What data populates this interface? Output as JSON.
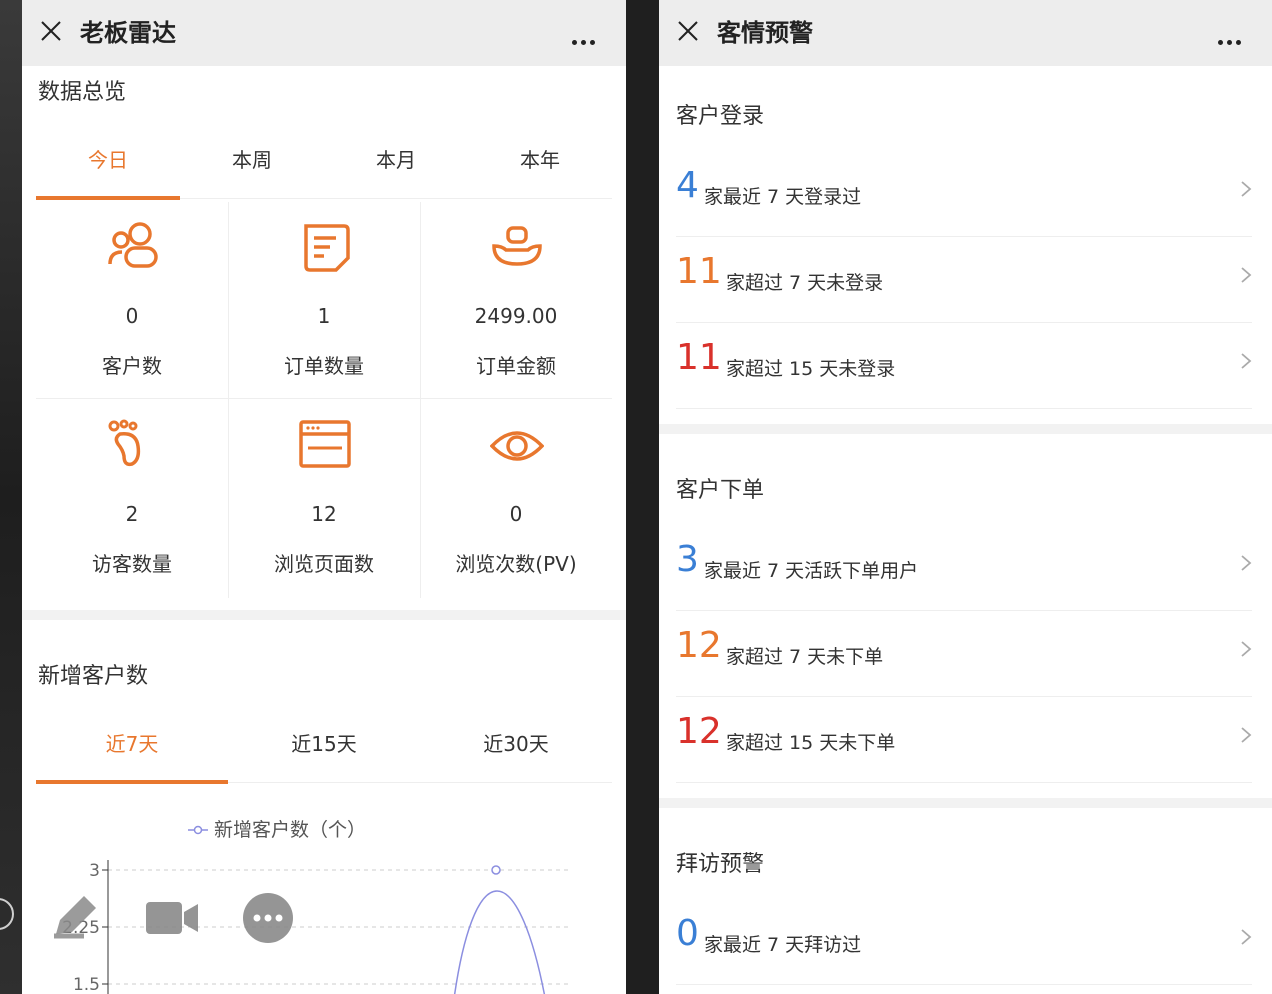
{
  "left": {
    "title": "老板雷达",
    "overview_title": "数据总览",
    "period_tabs": [
      "今日",
      "本周",
      "本月",
      "本年"
    ],
    "stats": [
      {
        "icon": "customers-icon",
        "value": "0",
        "label": "客户数"
      },
      {
        "icon": "order-document-icon",
        "value": "1",
        "label": "订单数量"
      },
      {
        "icon": "gold-ingot-icon",
        "value": "2499.00",
        "label": "订单金额"
      },
      {
        "icon": "footprint-icon",
        "value": "2",
        "label": "访客数量"
      },
      {
        "icon": "browser-window-icon",
        "value": "12",
        "label": "浏览页面数"
      },
      {
        "icon": "eye-icon",
        "value": "0",
        "label": "浏览次数(PV)"
      }
    ],
    "new_customers_title": "新增客户数",
    "range_tabs": [
      "近7天",
      "近15天",
      "近30天"
    ]
  },
  "chart_data": {
    "type": "line",
    "legend": "新增客户数（个）",
    "y_ticks": [
      "3",
      "2.25",
      "1.5"
    ],
    "ylim": [
      1.5,
      3
    ],
    "visible_peak": 3,
    "grid": true
  },
  "right": {
    "title": "客情预警",
    "sections": [
      {
        "title": "客户登录",
        "rows": [
          {
            "num": "4",
            "text": "家最近 7 天登录过",
            "color": "#3a7fd5"
          },
          {
            "num": "11",
            "text": "家超过 7 天未登录",
            "color": "#e8772e"
          },
          {
            "num": "11",
            "text": "家超过 15 天未登录",
            "color": "#d9312b"
          }
        ]
      },
      {
        "title": "客户下单",
        "rows": [
          {
            "num": "3",
            "text": "家最近 7 天活跃下单用户",
            "color": "#3a7fd5"
          },
          {
            "num": "12",
            "text": "家超过 7 天未下单",
            "color": "#e8772e"
          },
          {
            "num": "12",
            "text": "家超过 15 天未下单",
            "color": "#d9312b"
          }
        ]
      },
      {
        "title": "拜访预警",
        "rows": [
          {
            "num": "0",
            "text": "家最近 7 天拜访过",
            "color": "#3a7fd5"
          }
        ]
      }
    ]
  },
  "colors": {
    "accent": "#e8772e",
    "blue": "#3a7fd5",
    "red": "#d9312b",
    "chart_line": "#8b8ee0"
  }
}
